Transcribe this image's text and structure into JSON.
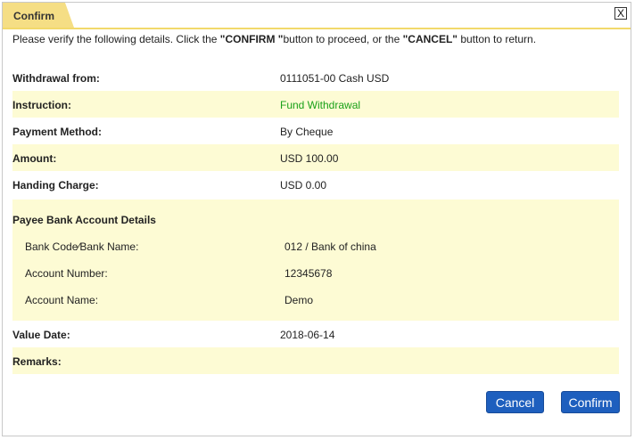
{
  "dialog": {
    "title": "Confirm",
    "close_glyph": "X",
    "intro_pre": "Please verify the following details. Click the ",
    "intro_confirm": "\"CONFIRM \"",
    "intro_mid": "button to proceed, or the ",
    "intro_cancel": "\"CANCEL\"",
    "intro_post": " button to return."
  },
  "details": {
    "withdrawal_from": {
      "label": "Withdrawal from:",
      "value": "0111051-00 Cash USD"
    },
    "instruction": {
      "label": "Instruction:",
      "value": "Fund Withdrawal"
    },
    "payment_method": {
      "label": "Payment Method:",
      "value": "By Cheque"
    },
    "amount": {
      "label": "Amount:",
      "value": "USD 100.00"
    },
    "handing_charge": {
      "label": "Handing Charge:",
      "value": "USD 0.00"
    }
  },
  "payee": {
    "title": "Payee Bank Account Details",
    "bank": {
      "label": "Bank Code∕Bank Name:",
      "value": "012 / Bank of china"
    },
    "account_number": {
      "label": "Account Number:",
      "value": "12345678"
    },
    "account_name": {
      "label": "Account Name:",
      "value": "Demo"
    }
  },
  "extra": {
    "value_date": {
      "label": "Value Date:",
      "value": "2018-06-14"
    },
    "remarks": {
      "label": "Remarks:",
      "value": ""
    }
  },
  "buttons": {
    "cancel": "Cancel",
    "confirm": "Confirm"
  },
  "colors": {
    "accent": "#1e5fbe",
    "highlight_row": "#fdfbd4",
    "tab": "#f5de85",
    "instruction_text": "#19a119"
  }
}
